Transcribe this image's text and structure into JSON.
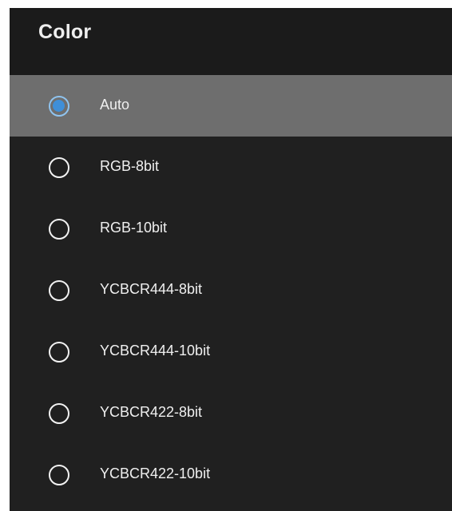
{
  "dialog": {
    "title": "Color",
    "selected_value": "Auto",
    "options": [
      {
        "label": "Auto",
        "selected": true
      },
      {
        "label": "RGB-8bit",
        "selected": false
      },
      {
        "label": "RGB-10bit",
        "selected": false
      },
      {
        "label": "YCBCR444-8bit",
        "selected": false
      },
      {
        "label": "YCBCR444-10bit",
        "selected": false
      },
      {
        "label": "YCBCR422-8bit",
        "selected": false
      },
      {
        "label": "YCBCR422-10bit",
        "selected": false
      }
    ]
  },
  "colors": {
    "background": "#202020",
    "header_background": "#1b1b1b",
    "selected_row": "#6e6e6e",
    "radio_selected": "#3f8fd8",
    "text": "#efefef"
  },
  "icons": {
    "radio_selected": "radio-selected-icon",
    "radio_unselected": "radio-unselected-icon"
  }
}
